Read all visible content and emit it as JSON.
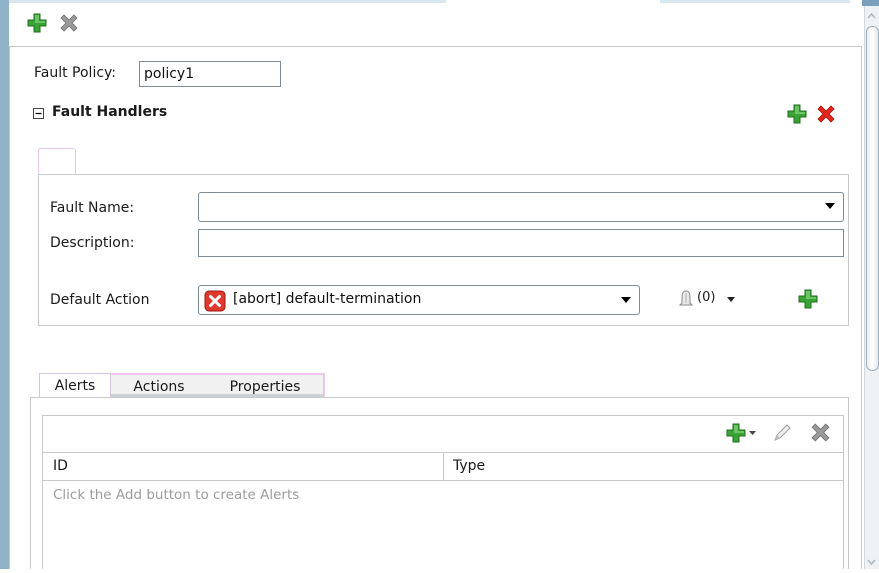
{
  "toolbar": {
    "add_icon": "plus-green-icon",
    "delete_icon": "x-gray-icon"
  },
  "fault_policy": {
    "label": "Fault Policy:",
    "value": "policy1"
  },
  "fault_handlers": {
    "title": "Fault Handlers",
    "collapse_icon": "minus-box-icon",
    "add_icon": "plus-green-icon",
    "delete_icon": "x-red-icon"
  },
  "form": {
    "fault_name_label": "Fault Name:",
    "fault_name_value": "",
    "description_label": "Description:",
    "description_value": "",
    "default_action_label": "Default Action",
    "default_action_value": "[abort] default-termination",
    "notifications_count": "(0)"
  },
  "tabs": [
    {
      "label": "Alerts",
      "active": true
    },
    {
      "label": "Actions",
      "active": false
    },
    {
      "label": "Properties",
      "active": false
    }
  ],
  "alerts_table": {
    "columns": [
      "ID",
      "Type"
    ],
    "empty_message": "Click the Add button to create Alerts"
  },
  "colors": {
    "add_green": "#3aa335",
    "delete_red": "#e2261c",
    "delete_gray": "#8a8a8a",
    "rail_blue": "#8fb3c6"
  }
}
